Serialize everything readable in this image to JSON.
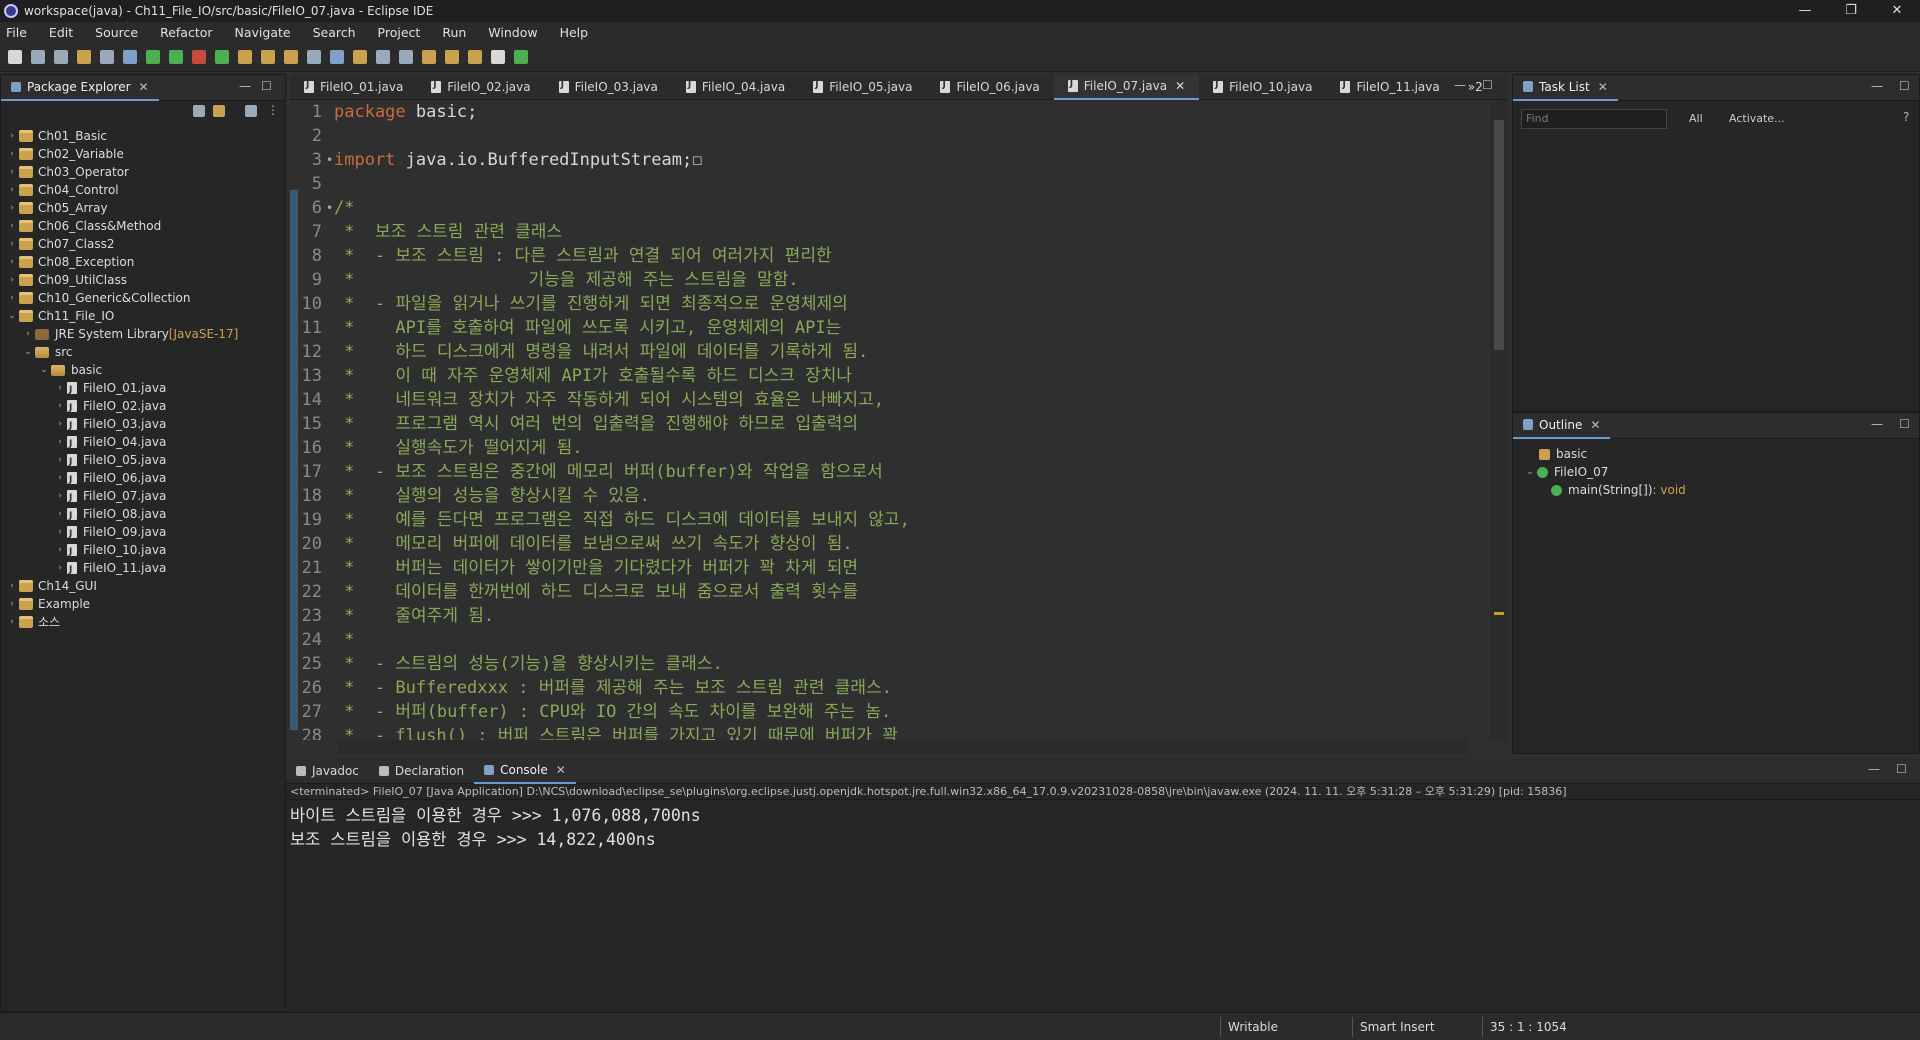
{
  "window": {
    "title": "workspace(java) - Ch11_File_IO/src/basic/FileIO_07.java - Eclipse IDE"
  },
  "menu": [
    "File",
    "Edit",
    "Source",
    "Refactor",
    "Navigate",
    "Search",
    "Project",
    "Run",
    "Window",
    "Help"
  ],
  "package_explorer": {
    "tab_label": "Package Explorer",
    "items": [
      {
        "label": "Ch01_Basic",
        "depth": 0,
        "kind": "project",
        "tw": "›"
      },
      {
        "label": "Ch02_Variable",
        "depth": 0,
        "kind": "project",
        "tw": "›"
      },
      {
        "label": "Ch03_Operator",
        "depth": 0,
        "kind": "project",
        "tw": "›"
      },
      {
        "label": "Ch04_Control",
        "depth": 0,
        "kind": "project",
        "tw": "›"
      },
      {
        "label": "Ch05_Array",
        "depth": 0,
        "kind": "project",
        "tw": "›"
      },
      {
        "label": "Ch06_Class&Method",
        "depth": 0,
        "kind": "project",
        "tw": "›"
      },
      {
        "label": "Ch07_Class2",
        "depth": 0,
        "kind": "project",
        "tw": "›"
      },
      {
        "label": "Ch08_Exception",
        "depth": 0,
        "kind": "project",
        "tw": "›"
      },
      {
        "label": "Ch09_UtilClass",
        "depth": 0,
        "kind": "project",
        "tw": "›"
      },
      {
        "label": "Ch10_Generic&Collection",
        "depth": 0,
        "kind": "project",
        "tw": "›"
      },
      {
        "label": "Ch11_File_IO",
        "depth": 0,
        "kind": "project",
        "tw": "⌄"
      },
      {
        "label": "JRE System Library",
        "suffix": " [JavaSE-17]",
        "depth": 1,
        "kind": "lib",
        "tw": "›"
      },
      {
        "label": "src",
        "depth": 1,
        "kind": "folder",
        "tw": "⌄"
      },
      {
        "label": "basic",
        "depth": 2,
        "kind": "package",
        "tw": "⌄"
      },
      {
        "label": "FileIO_01.java",
        "depth": 3,
        "kind": "java",
        "tw": "›"
      },
      {
        "label": "FileIO_02.java",
        "depth": 3,
        "kind": "java",
        "tw": "›"
      },
      {
        "label": "FileIO_03.java",
        "depth": 3,
        "kind": "java",
        "tw": "›"
      },
      {
        "label": "FileIO_04.java",
        "depth": 3,
        "kind": "java",
        "tw": "›"
      },
      {
        "label": "FileIO_05.java",
        "depth": 3,
        "kind": "java",
        "tw": "›"
      },
      {
        "label": "FileIO_06.java",
        "depth": 3,
        "kind": "java",
        "tw": "›"
      },
      {
        "label": "FileIO_07.java",
        "depth": 3,
        "kind": "java",
        "tw": "›"
      },
      {
        "label": "FileIO_08.java",
        "depth": 3,
        "kind": "java",
        "tw": "›"
      },
      {
        "label": "FileIO_09.java",
        "depth": 3,
        "kind": "java",
        "tw": "›"
      },
      {
        "label": "FileIO_10.java",
        "depth": 3,
        "kind": "java",
        "tw": "›"
      },
      {
        "label": "FileIO_11.java",
        "depth": 3,
        "kind": "java",
        "tw": "›"
      },
      {
        "label": "Ch14_GUI",
        "depth": 0,
        "kind": "project",
        "tw": "›"
      },
      {
        "label": "Example",
        "depth": 0,
        "kind": "project",
        "tw": "›"
      },
      {
        "label": "소스",
        "depth": 0,
        "kind": "project",
        "tw": "›"
      }
    ]
  },
  "editor": {
    "tabs": [
      "FileIO_01.java",
      "FileIO_02.java",
      "FileIO_03.java",
      "FileIO_04.java",
      "FileIO_05.java",
      "FileIO_06.java",
      "FileIO_07.java",
      "FileIO_10.java",
      "FileIO_11.java"
    ],
    "active_tab": "FileIO_07.java",
    "overflow": "»2",
    "lines": [
      {
        "n": "1",
        "parts": [
          {
            "t": "package",
            "c": "kw"
          },
          {
            "t": " basic;",
            "c": "plain"
          }
        ]
      },
      {
        "n": "2",
        "parts": []
      },
      {
        "n": "3",
        "fold": "•",
        "parts": [
          {
            "t": "import",
            "c": "kw"
          },
          {
            "t": " java.io.BufferedInputStream;",
            "c": "plain"
          },
          {
            "t": "☐",
            "c": "plain"
          }
        ]
      },
      {
        "n": "5",
        "parts": []
      },
      {
        "n": "6",
        "fold": "•",
        "parts": [
          {
            "t": "/*",
            "c": "ct"
          }
        ]
      },
      {
        "n": "7",
        "parts": [
          {
            "t": " *  보조 스트림 관련 클래스",
            "c": "ct"
          }
        ]
      },
      {
        "n": "8",
        "parts": [
          {
            "t": " *  - 보조 스트림 : 다른 스트림과 연결 되어 여러가지 편리한",
            "c": "ct"
          }
        ]
      },
      {
        "n": "9",
        "parts": [
          {
            "t": " *                 기능을 제공해 주는 스트림을 말함.",
            "c": "ct"
          }
        ]
      },
      {
        "n": "10",
        "parts": [
          {
            "t": " *  - 파일을 읽거나 쓰기를 진행하게 되면 최종적으로 운영체제의",
            "c": "ct"
          }
        ]
      },
      {
        "n": "11",
        "parts": [
          {
            "t": " *    API를 호출하여 파일에 쓰도록 시키고, 운영체제의 API는",
            "c": "ct"
          }
        ]
      },
      {
        "n": "12",
        "parts": [
          {
            "t": " *    하드 디스크에게 명령을 내려서 파일에 데이터를 기록하게 됨.",
            "c": "ct"
          }
        ]
      },
      {
        "n": "13",
        "parts": [
          {
            "t": " *    이 때 자주 운영체제 API가 호출될수록 하드 디스크 장치나",
            "c": "ct"
          }
        ]
      },
      {
        "n": "14",
        "parts": [
          {
            "t": " *    네트워크 장치가 자주 작동하게 되어 시스템의 효율은 나빠지고,",
            "c": "ct"
          }
        ]
      },
      {
        "n": "15",
        "parts": [
          {
            "t": " *    프로그램 역시 여러 번의 입출력을 진행해야 하므로 입출력의",
            "c": "ct"
          }
        ]
      },
      {
        "n": "16",
        "parts": [
          {
            "t": " *    실행속도가 떨어지게 됨.",
            "c": "ct"
          }
        ]
      },
      {
        "n": "17",
        "parts": [
          {
            "t": " *  - 보조 스트림은 중간에 메모리 버퍼(buffer)와 작업을 함으로서",
            "c": "ct"
          }
        ]
      },
      {
        "n": "18",
        "parts": [
          {
            "t": " *    실행의 성능을 향상시킬 수 있음.",
            "c": "ct"
          }
        ]
      },
      {
        "n": "19",
        "parts": [
          {
            "t": " *    예를 든다면 프로그램은 직접 하드 디스크에 데이터를 보내지 않고,",
            "c": "ct"
          }
        ]
      },
      {
        "n": "20",
        "parts": [
          {
            "t": " *    메모리 버퍼에 데이터를 보냄으로써 쓰기 속도가 향상이 됨.",
            "c": "ct"
          }
        ]
      },
      {
        "n": "21",
        "parts": [
          {
            "t": " *    버퍼는 데이터가 쌓이기만을 기다렸다가 버퍼가 꽉 차게 되면",
            "c": "ct"
          }
        ]
      },
      {
        "n": "22",
        "parts": [
          {
            "t": " *    데이터를 한꺼번에 하드 디스크로 보내 줌으로서 출력 횟수를",
            "c": "ct"
          }
        ]
      },
      {
        "n": "23",
        "parts": [
          {
            "t": " *    줄여주게 됨.",
            "c": "ct"
          }
        ]
      },
      {
        "n": "24",
        "parts": [
          {
            "t": " *",
            "c": "ct"
          }
        ]
      },
      {
        "n": "25",
        "parts": [
          {
            "t": " *  - 스트림의 성능(기능)을 향상시키는 클래스.",
            "c": "ct"
          }
        ]
      },
      {
        "n": "26",
        "parts": [
          {
            "t": " *  - Bufferedxxx : 버퍼를 제공해 주는 보조 스트림 관련 클래스.",
            "c": "ct"
          }
        ]
      },
      {
        "n": "27",
        "parts": [
          {
            "t": " *  - 버퍼(buffer) : CPU와 IO 간의 속도 차이를 보완해 주는 놈.",
            "c": "ct"
          }
        ]
      },
      {
        "n": "28",
        "parts": [
          {
            "t": " *  - flush() : 버퍼 스트림은 버퍼를 가지고 있기 때문에 버퍼가 꽉",
            "c": "ct"
          }
        ]
      }
    ]
  },
  "task_list": {
    "tab_label": "Task List",
    "find_placeholder": "Find",
    "all_label": "All",
    "activate_label": "Activate..."
  },
  "outline": {
    "tab_label": "Outline",
    "items": [
      {
        "label": "basic",
        "extra": ""
      },
      {
        "label": "FileIO_07",
        "extra": ""
      },
      {
        "label": "main(String[])",
        "extra": " : void"
      }
    ]
  },
  "console": {
    "tabs": [
      "Javadoc",
      "Declaration",
      "Console"
    ],
    "active_tab": "Console",
    "info": "<terminated> FileIO_07 [Java Application] D:\\NCS\\download\\eclipse_se\\plugins\\org.eclipse.justj.openjdk.hotspot.jre.full.win32.x86_64_17.0.9.v20231028-0858\\jre\\bin\\javaw.exe  (2024. 11. 11. 오후 5:31:28 – 오후 5:31:29) [pid: 15836]",
    "output": [
      "바이트 스트림을 이용한 경우 >>> 1,076,088,700ns",
      "보조 스트림을 이용한 경우 >>> 14,822,400ns"
    ]
  },
  "status": {
    "writable": "Writable",
    "insert_mode": "Smart Insert",
    "position": "35 : 1 : 1054"
  },
  "colors": {
    "accent": "#6a9ccf",
    "comment": "#8aa85a",
    "keyword": "#c86b3f"
  }
}
